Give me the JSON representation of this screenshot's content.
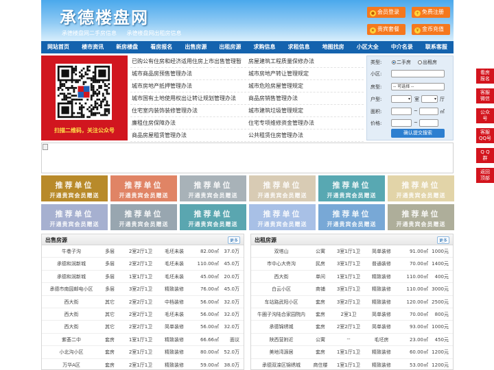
{
  "header": {
    "logo": "承德楼盘网",
    "slogans": [
      "承德楼盘网二手房信息",
      "承德楼盘网出租房信息"
    ],
    "buttons": [
      {
        "label": "会员登录",
        "icon": "user-icon"
      },
      {
        "label": "免费注册",
        "icon": "register-icon"
      },
      {
        "label": "贵宾套餐",
        "icon": "vip-icon"
      },
      {
        "label": "金币充值",
        "icon": "coin-icon"
      }
    ]
  },
  "nav": [
    "网站首页",
    "楼市资讯",
    "新房楼盘",
    "看房报名",
    "出售房源",
    "出租房源",
    "求购信息",
    "求租信息",
    "地图找房",
    "小区大全",
    "中介名录",
    "联系客服"
  ],
  "qr": {
    "caption": "扫描二维码，关注公众号"
  },
  "policy_links": [
    [
      "已购公有住房和经济适用住房上市出售管理暂",
      "房屋建筑工程质量保修办法"
    ],
    [
      "城市商品房预售管理办法",
      "城市房地产转让管理规定"
    ],
    [
      "城市房地产抵押管理办法",
      "城市危险房屋管理规定"
    ],
    [
      "城市国有土地使用权出让转让规划管理办法",
      "商品房销售管理办法"
    ],
    [
      "住宅室内装饰装修管理办法",
      "城市建筑垃圾管理规定"
    ],
    [
      "廉租住房保障办法",
      "住宅专项维修资金管理办法"
    ],
    [
      "商品房屋租赁管理办法",
      "公共租赁住房管理办法"
    ]
  ],
  "search": {
    "type_label": "类型:",
    "type_options": [
      "二手房",
      "出租房"
    ],
    "community_label": "小区:",
    "housetype_label": "房型:",
    "housetype_value": "-- 可选择 --",
    "layout_label": "户型:",
    "room_unit": "室",
    "hall_unit": "厅",
    "area_label": "面积:",
    "area_unit": "㎡",
    "price_label": "价格:",
    "range_sep": "~",
    "submit": "确认提交搜索"
  },
  "ad_tiles": {
    "title": "推荐单位",
    "subtitle": "开通贵宾会员赠送",
    "colors": [
      "#b88a2a",
      "#e08465",
      "#a8b2b8",
      "#d8cbb4",
      "#58a8b2",
      "#e2d4a8",
      "#a6b0d0",
      "#98a6b0",
      "#5aa6b0",
      "#a8c0e6",
      "#78a8d6",
      "#aeae9a"
    ]
  },
  "sale": {
    "title": "出售房源",
    "more": "更多",
    "rows": [
      [
        "牛巷子沟",
        "多层",
        "2室2厅1卫",
        "毛坯未装",
        "82.00㎡",
        "37.0万"
      ],
      [
        "承德和润新城",
        "多层",
        "2室2厅1卫",
        "毛坯未装",
        "110.00㎡",
        "45.0万"
      ],
      [
        "承德和润新城",
        "多层",
        "1室1厅1卫",
        "毛坯未装",
        "45.00㎡",
        "20.0万"
      ],
      [
        "承德市南园邮电小区",
        "多层",
        "3室2厅1卫",
        "精致装修",
        "76.00㎡",
        "45.0万"
      ],
      [
        "西大街",
        "其它",
        "2室2厅1卫",
        "中档装修",
        "56.00㎡",
        "32.0万"
      ],
      [
        "西大街",
        "其它",
        "2室2厅1卫",
        "毛坯未装",
        "56.00㎡",
        "32.0万"
      ],
      [
        "西大街",
        "其它",
        "2室2厅1卫",
        "简单装修",
        "56.00㎡",
        "32.0万"
      ],
      [
        "紫荟二中",
        "套房",
        "1室1厅1卫",
        "精致装修",
        "66.66㎡",
        "面议"
      ],
      [
        "小北沟小区",
        "套房",
        "2室1厅1卫",
        "精致装修",
        "80.00㎡",
        "52.0万"
      ],
      [
        "万华A区",
        "套房",
        "2室1厅1卫",
        "精致装修",
        "59.00㎡",
        "38.0万"
      ]
    ]
  },
  "rent": {
    "title": "出租房源",
    "more": "更多",
    "rows": [
      [
        "双塔山",
        "公寓",
        "3室1厅1卫",
        "简单装修",
        "91.00㎡",
        "1000元"
      ],
      [
        "市中心大佟沟",
        "民房",
        "3室1厅1卫",
        "普通装修",
        "70.00㎡",
        "1400元"
      ],
      [
        "西大街",
        "单间",
        "1室1厅1卫",
        "精致装修",
        "110.00㎡",
        "400元"
      ],
      [
        "白云小区",
        "商铺",
        "3室1厅1卫",
        "精致装修",
        "110.00㎡",
        "3000元"
      ],
      [
        "车站路武阳小区",
        "套房",
        "3室2厅1卫",
        "精致装修",
        "120.00㎡",
        "2500元"
      ],
      [
        "牛圈子沟陆合家园院内",
        "套房",
        "2室1卫",
        "简单装修",
        "70.00㎡",
        "800元"
      ],
      [
        "承德锦绣城",
        "套房",
        "2室2厅1卫",
        "简单装修",
        "93.00㎡",
        "1000元"
      ],
      [
        "陕西营附近",
        "公寓",
        "--",
        "毛坯房",
        "23.00㎡",
        "450元"
      ],
      [
        "美地湾源居",
        "套房",
        "1室1厅1卫",
        "精致装修",
        "60.00㎡",
        "1200元"
      ],
      [
        "承德双滦区锦绣城",
        "商住楼",
        "1室1厅1卫",
        "精致装修",
        "53.00㎡",
        "1200元"
      ]
    ]
  },
  "side_links": [
    [
      "看房",
      "报名"
    ],
    [
      "客服",
      "微信"
    ],
    [
      "公众",
      "号"
    ],
    [
      "客服",
      "QQ号"
    ],
    [
      "Q Q",
      "群"
    ],
    [
      "返回",
      "顶部"
    ]
  ]
}
